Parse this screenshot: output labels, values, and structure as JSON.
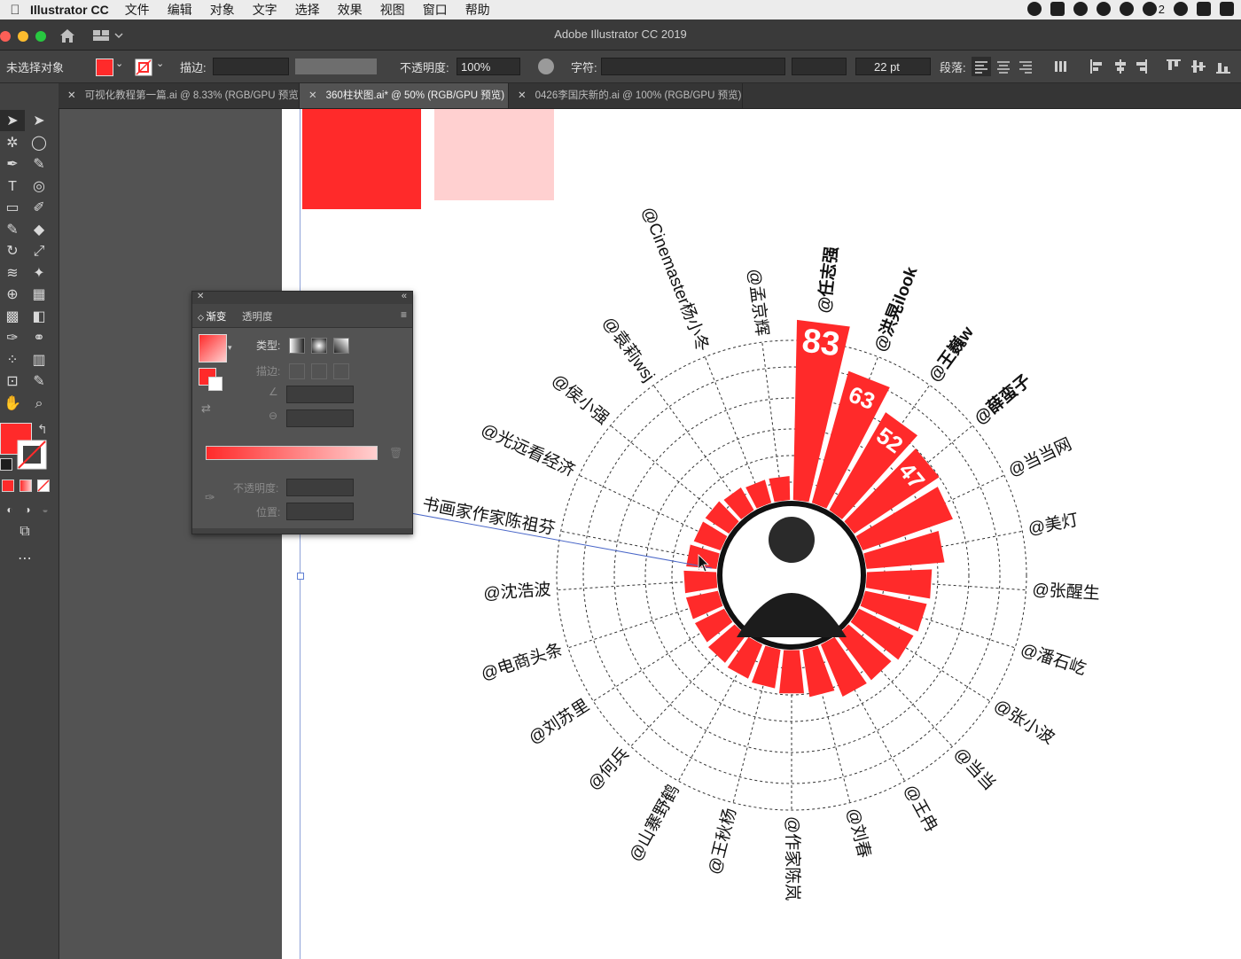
{
  "menubar": {
    "app": "Illustrator CC",
    "items": [
      "文件",
      "编辑",
      "对象",
      "文字",
      "选择",
      "效果",
      "视图",
      "窗口",
      "帮助"
    ],
    "status_count": "2"
  },
  "window": {
    "title": "Adobe Illustrator CC 2019"
  },
  "control_bar": {
    "selection": "未选择对象",
    "stroke_label": "描边:",
    "opacity_label": "不透明度:",
    "opacity_value": "100%",
    "char_label": "字符:",
    "font_size": "22 pt",
    "para_label": "段落:"
  },
  "doc_tabs": [
    {
      "label": "可视化教程第一篇.ai @ 8.33% (RGB/GPU 预览)",
      "active": false
    },
    {
      "label": "360柱状图.ai* @ 50% (RGB/GPU 预览)",
      "active": true
    },
    {
      "label": "0426李国庆新的.ai @ 100% (RGB/GPU 预览)",
      "active": false
    }
  ],
  "gradient_panel": {
    "tab_gradient": "渐变",
    "tab_transparency": "透明度",
    "type_label": "类型:",
    "stroke_label": "描边:",
    "opacity_label": "不透明度:",
    "position_label": "位置:"
  },
  "colors": {
    "bar_red": "#ff2a2a",
    "swatch_light": "#ffd0d0"
  },
  "chart_data": {
    "type": "bar",
    "layout": "radial",
    "categories": [
      "@任志强",
      "@洪晃ilook",
      "@王巍w",
      "@薛蛮子",
      "@当当网",
      "@美灯",
      "@张醒生",
      "@潘石屹",
      "@张小波",
      "@当当",
      "@王冉",
      "@刘春",
      "@作家陈岚",
      "@王秋杨",
      "@山寨野鹤",
      "@何兵",
      "@刘苏里",
      "@电商头条",
      "@沈浩波",
      "书画家作家陈祖芬",
      "@光远看经济",
      "@侯小强",
      "@袁莉wsj",
      "@Cinemaster杨小冬",
      "@孟京辉"
    ],
    "values": [
      83,
      63,
      52,
      47,
      44,
      36,
      30,
      29,
      28,
      26,
      26,
      22,
      20,
      18,
      17,
      16,
      15,
      15,
      15,
      14,
      13,
      13,
      12,
      11,
      11
    ],
    "data_labels": [
      "83",
      "63",
      "52",
      "47"
    ]
  }
}
